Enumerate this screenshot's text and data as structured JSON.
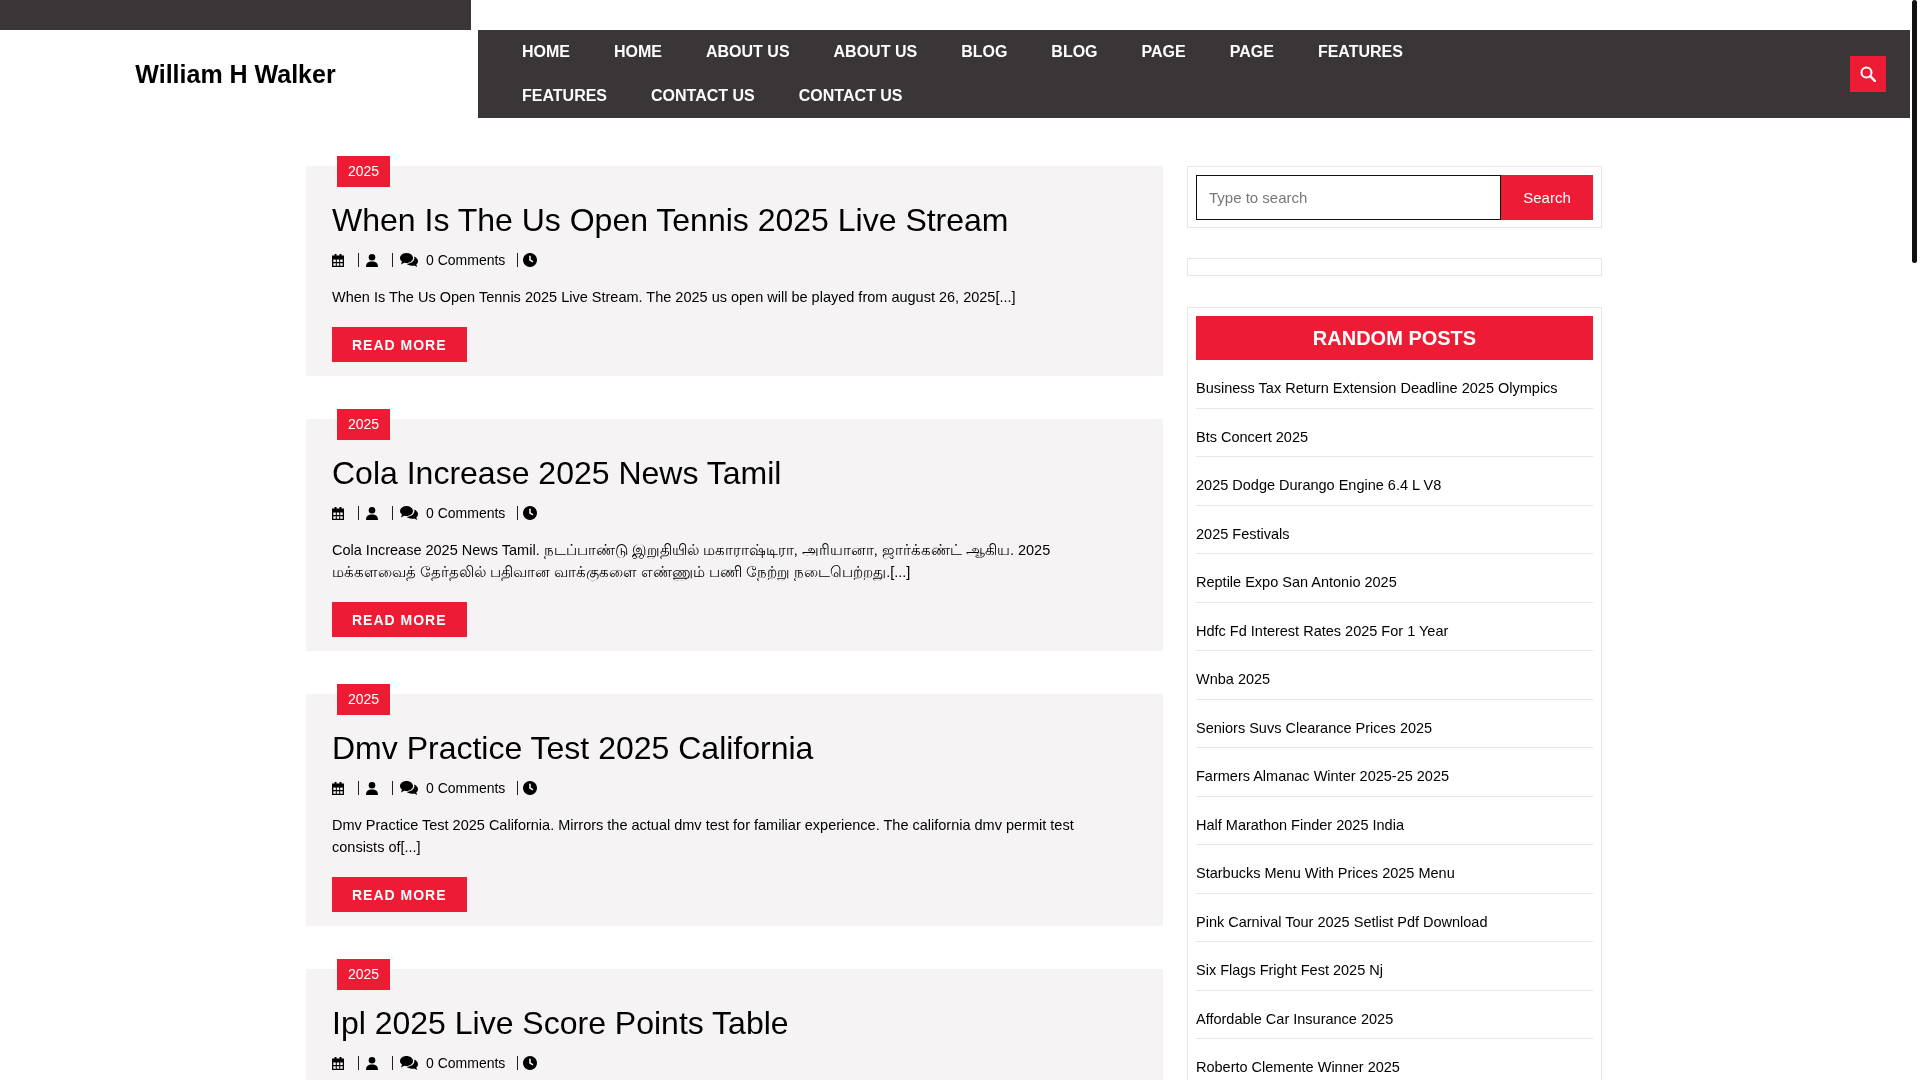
{
  "site": {
    "title": "William H Walker"
  },
  "nav": {
    "items": [
      "HOME",
      "HOME",
      "ABOUT US",
      "ABOUT US",
      "BLOG",
      "BLOG",
      "PAGE",
      "PAGE",
      "FEATURES",
      "FEATURES",
      "CONTACT US",
      "CONTACT US"
    ]
  },
  "posts": [
    {
      "category": "2025",
      "title": "When Is The Us Open Tennis 2025 Live Stream",
      "comments": "0 Comments",
      "excerpt": "When Is The Us Open Tennis 2025 Live Stream. The 2025 us open will be played from august 26, 2025[...]",
      "button": "READ MORE"
    },
    {
      "category": "2025",
      "title": "Cola Increase 2025 News Tamil",
      "comments": "0 Comments",
      "excerpt": "Cola Increase 2025 News Tamil. நடப்பாண்டு இறுதியில் மகாராஷ்டிரா, அரியானா, ஜார்க்கண்ட் ஆகிய. 2025 மக்களவைத் தேர்தலில் பதிவான வாக்குகளை எண்ணும் பணி நேற்று நடைபெற்றது.[...]",
      "button": "READ MORE"
    },
    {
      "category": "2025",
      "title": "Dmv Practice Test 2025 California",
      "comments": "0 Comments",
      "excerpt": "Dmv Practice Test 2025 California. Mirrors the actual dmv test for familiar experience. The california dmv permit test consists of[...]",
      "button": "READ MORE"
    },
    {
      "category": "2025",
      "title": "Ipl 2025 Live Score Points Table",
      "comments": "0 Comments"
    }
  ],
  "sidebar": {
    "search": {
      "placeholder": "Type to search",
      "button": "Search"
    },
    "random_posts": {
      "title": "RANDOM POSTS",
      "items": [
        "Business Tax Return Extension Deadline 2025 Olympics",
        "Bts Concert 2025",
        "2025 Dodge Durango Engine 6.4 L V8",
        "2025 Festivals",
        "Reptile Expo San Antonio 2025",
        "Hdfc Fd Interest Rates 2025 For 1 Year",
        "Wnba 2025",
        "Seniors Suvs Clearance Prices 2025",
        "Farmers Almanac Winter 2025-25 2025",
        "Half Marathon Finder 2025 India",
        "Starbucks Menu With Prices 2025 Menu",
        "Pink Carnival Tour 2025 Setlist Pdf Download",
        "Six Flags Fright Fest 2025 Nj",
        "Affordable Car Insurance 2025",
        "Roberto Clemente Winner 2025"
      ]
    }
  }
}
